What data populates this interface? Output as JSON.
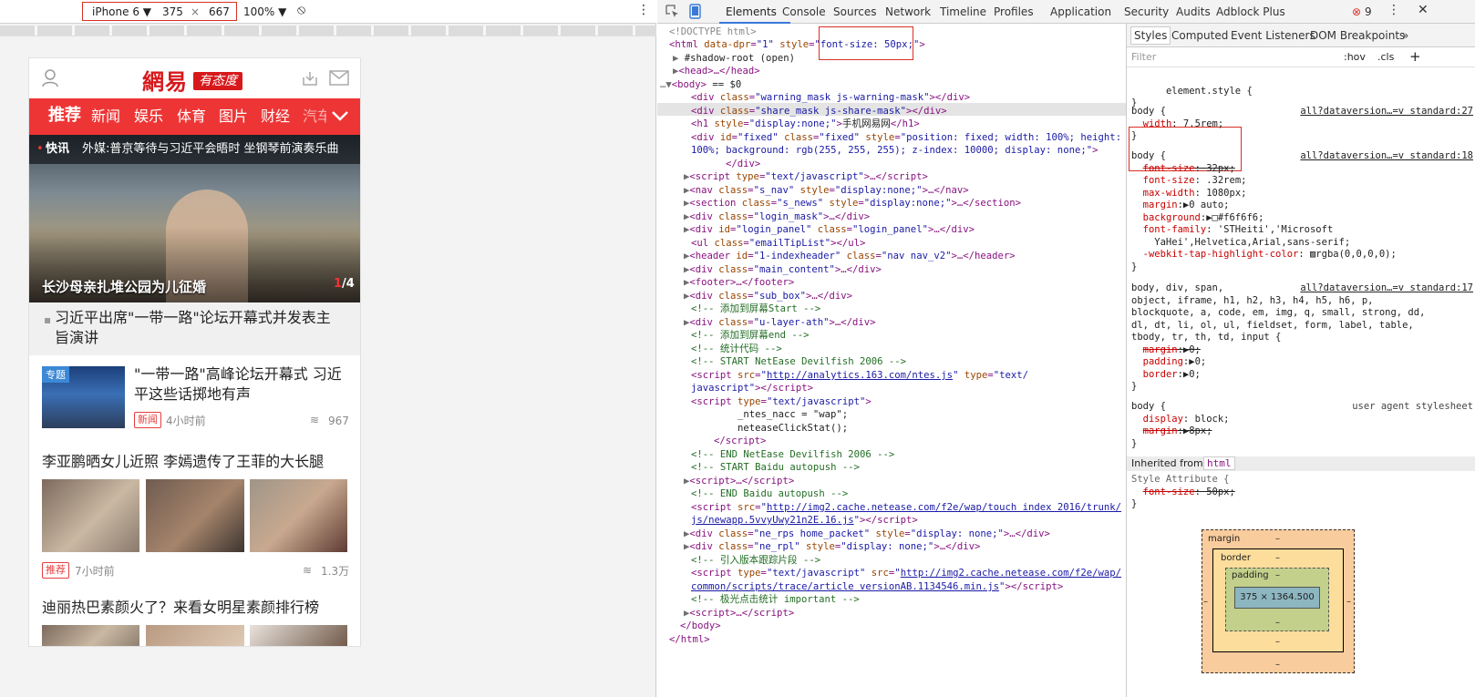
{
  "device_toolbar": {
    "device": "iPhone 6",
    "width": "375",
    "times": "×",
    "height": "667",
    "zoom": "100%"
  },
  "mobile": {
    "logo": "網易",
    "slogan": "有态度",
    "nav_items": [
      "推荐",
      "新闻",
      "娱乐",
      "体育",
      "图片",
      "财经",
      "汽车"
    ],
    "flash_label": "快讯",
    "flash_text": "外媒:普京等待与习近平会晤时 坐钢琴前演奏乐曲",
    "hero_caption": "长沙母亲扎堆公园为儿征婚",
    "hero_page_current": "1",
    "hero_page_total": "/4",
    "headline": "习近平出席\"一带一路\"论坛开幕式并发表主旨演讲",
    "article1": {
      "badge": "专题",
      "title": "\"一带一路\"高峰论坛开幕式 习近平这些话掷地有声",
      "tag": "新闻",
      "time": "4小时前",
      "comments": "967"
    },
    "article2": {
      "title": "李亚鹏晒女儿近照 李嫣遗传了王菲的大长腿",
      "tag": "推荐",
      "time": "7小时前",
      "comments": "1.3万"
    },
    "article3": {
      "title": "迪丽热巴素颜火了？来看女明星素颜排行榜"
    }
  },
  "devtools": {
    "tabs": [
      "Elements",
      "Console",
      "Sources",
      "Network",
      "Timeline",
      "Profiles",
      "Application",
      "Security",
      "Audits",
      "Adblock Plus"
    ],
    "error_count": "9",
    "styles_tabs": [
      "Styles",
      "Computed",
      "Event Listeners",
      "DOM Breakpoints"
    ],
    "filter_placeholder": "Filter",
    "hov": ":hov",
    "cls": ".cls",
    "element_style": "element.style {",
    "inherited_from": "Inherited from",
    "inherited_tag": "html",
    "style_attribute": "Style Attribute {",
    "source_ref_27": "all?dataversion…=v standard:27",
    "source_ref_18": "all?dataversion…=v standard:18",
    "source_ref_17": "all?dataversion…=v standard:17",
    "user_agent": "user agent stylesheet",
    "box_model": {
      "margin": "margin",
      "border": "border",
      "padding": "padding",
      "dash": "–",
      "content": "375 × 1364.500"
    }
  },
  "colors": {
    "netease_red": "#ee3535",
    "highlight_red": "#d93025",
    "devtools_blue": "#3879d9"
  }
}
